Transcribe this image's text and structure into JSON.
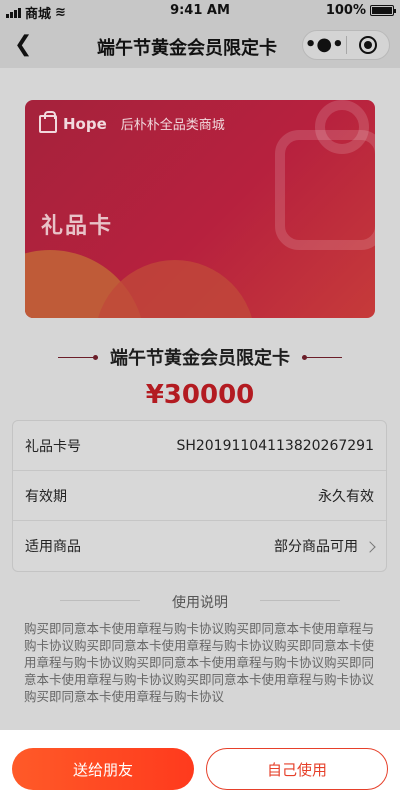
{
  "status_bar": {
    "carrier": "商城",
    "time": "9:41 AM",
    "battery": "100%"
  },
  "nav": {
    "back_icon": "chevron-left-icon",
    "title": "端午节黄金会员限定卡",
    "more_icon": "more-dots-icon",
    "close_icon": "target-icon"
  },
  "card": {
    "brand": "Hope",
    "store": "后朴朴全品类商城",
    "type": "礼品卡"
  },
  "title": "端午节黄金会员限定卡",
  "price": "¥30000",
  "info": {
    "rows": [
      {
        "label": "礼品卡号",
        "value": "SH2019110411382026729​1"
      },
      {
        "label": "有效期",
        "value": "永久有效"
      },
      {
        "label": "适用商品",
        "value": "部分商品可用"
      }
    ]
  },
  "usage": {
    "title": "使用说明",
    "text": "购买即同意本卡使用章程与购卡协议购买即同意本卡使用章程与购卡协议购买即同意本卡使用章程与购卡协议购买即同意本卡使用章程与购卡协议购买即同意本卡使用章程与购卡协议购买即同意本卡使用章程与购卡协议购买即同意本卡使用章程与购卡协议购买即同意本卡使用章程与购卡协议"
  },
  "actions": {
    "send": "送给朋友",
    "self": "自己使用"
  },
  "colors": {
    "accent": "#ff4a22",
    "price": "#b31b21",
    "card": "#b7213e"
  }
}
